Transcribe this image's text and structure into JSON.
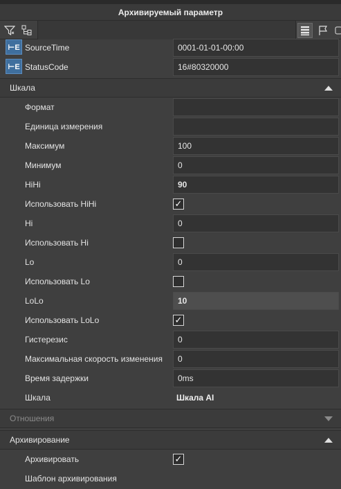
{
  "window": {
    "title": "Архивируемый параметр"
  },
  "toolbar": {
    "filter_icon": "filter-icon",
    "tree_icon": "tree-expand-icon",
    "list_view_icon": "list-view-icon",
    "flag_icon": "flag-icon"
  },
  "variables": [
    {
      "label": "SourceTime",
      "value": "0001-01-01-00:00"
    },
    {
      "label": "StatusCode",
      "value": "16#80320000"
    }
  ],
  "sections": {
    "scale": {
      "title": "Шкала",
      "expanded": true
    },
    "relations": {
      "title": "Отношения",
      "expanded": false
    },
    "archiving": {
      "title": "Архивирование",
      "expanded": true
    }
  },
  "scale_rows": {
    "format": {
      "label": "Формат",
      "value": ""
    },
    "unit": {
      "label": "Единица измерения",
      "value": ""
    },
    "max": {
      "label": "Максимум",
      "value": "100"
    },
    "min": {
      "label": "Минимум",
      "value": "0"
    },
    "hihi": {
      "label": "HiHi",
      "value": "90"
    },
    "use_hihi": {
      "label": "Использовать HiHi",
      "checked": true
    },
    "hi": {
      "label": "Hi",
      "value": "0"
    },
    "use_hi": {
      "label": "Использовать Hi",
      "checked": false
    },
    "lo": {
      "label": "Lo",
      "value": "0"
    },
    "use_lo": {
      "label": "Использовать Lo",
      "checked": false
    },
    "lolo": {
      "label": "LoLo",
      "value": "10"
    },
    "use_lolo": {
      "label": "Использовать LoLo",
      "checked": true
    },
    "hysteresis": {
      "label": "Гистерезис",
      "value": "0"
    },
    "max_rate": {
      "label": "Максимальная скорость изменения",
      "value": "0"
    },
    "delay": {
      "label": "Время задержки",
      "value": "0ms"
    },
    "scale": {
      "label": "Шкала",
      "value": "Шкала AI"
    }
  },
  "archiving_rows": {
    "archive": {
      "label": "Архивировать",
      "checked": true
    },
    "template": {
      "label": "Шаблон архивирования"
    }
  },
  "checkmark": "✓"
}
